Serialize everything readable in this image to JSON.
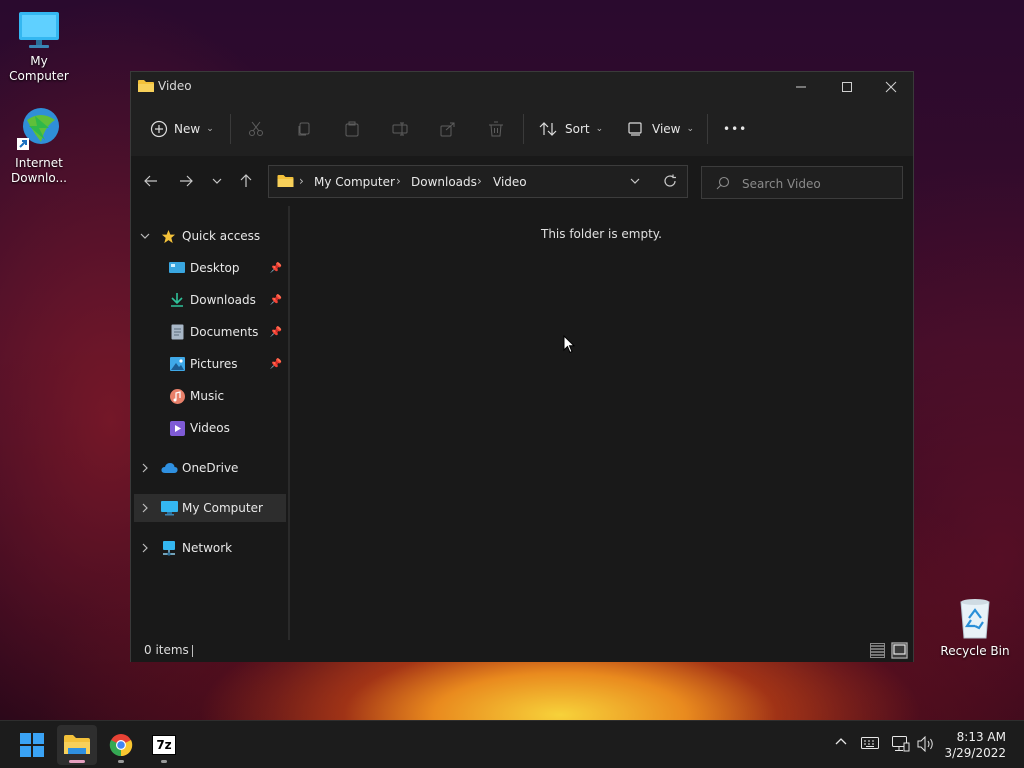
{
  "desktop": {
    "icons": [
      {
        "label": "My Computer"
      },
      {
        "label": "Internet Downlo..."
      },
      {
        "label": "Recycle Bin"
      }
    ]
  },
  "window": {
    "title": "Video",
    "toolbar": {
      "new_label": "New",
      "sort_label": "Sort",
      "view_label": "View",
      "more_label": "•••"
    },
    "breadcrumb": [
      "My Computer",
      "Downloads",
      "Video"
    ],
    "search_placeholder": "Search Video",
    "sidebar": {
      "quick_access": "Quick access",
      "items": [
        {
          "label": "Desktop"
        },
        {
          "label": "Downloads"
        },
        {
          "label": "Documents"
        },
        {
          "label": "Pictures"
        },
        {
          "label": "Music"
        },
        {
          "label": "Videos"
        }
      ],
      "onedrive": "OneDrive",
      "my_computer": "My Computer",
      "network": "Network"
    },
    "empty_message": "This folder is empty.",
    "status": "0 items"
  },
  "taskbar": {
    "time": "8:13 AM",
    "date": "3/29/2022",
    "sevenzip_label": "7z"
  },
  "colors": {
    "accent": "#0078d4",
    "folder": "#f3c13a"
  }
}
